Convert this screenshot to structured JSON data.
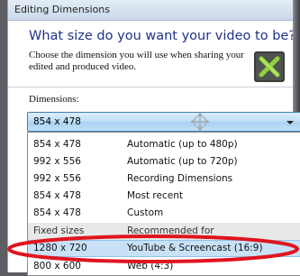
{
  "window": {
    "title": "Editing Dimensions"
  },
  "header": {
    "heading": "What size do you want your video to be?",
    "description": "Choose the dimension you will use when sharing your edited and produced video."
  },
  "form": {
    "dimensions_label": "Dimensions:",
    "selected_value": "854 x 478"
  },
  "dropdown": {
    "options": [
      {
        "size": "854 x 478",
        "description": "Automatic (up to 480p)"
      },
      {
        "size": "992 x 556",
        "description": "Automatic (up to 720p)"
      },
      {
        "size": "992 x 556",
        "description": "Recording Dimensions"
      },
      {
        "size": "854 x 478",
        "description": "Most recent"
      },
      {
        "size": "854 x 478",
        "description": "Custom"
      }
    ],
    "group_header": {
      "size": "Fixed sizes",
      "description": "Recommended for"
    },
    "fixed_options": [
      {
        "size": "1280 x 720",
        "description": "YouTube & Screencast (16:9)"
      },
      {
        "size": "800 x 600",
        "description": "Web (4:3)"
      }
    ],
    "hovered_option": "1280 x 720"
  },
  "colors": {
    "heading": "#1e3287",
    "highlight_ring": "#e0141e",
    "selection": "#c8e1f6",
    "combo_border": "#3c7fb1"
  },
  "icons": {
    "app_logo": "camtasia-logo-icon",
    "cursor": "move-cursor-icon",
    "dropdown": "chevron-down-icon"
  }
}
